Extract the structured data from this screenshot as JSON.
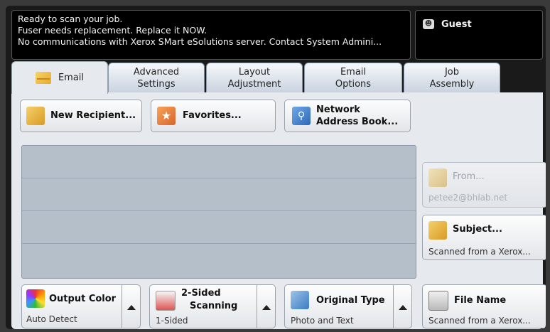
{
  "status": {
    "lines": [
      "Ready to scan your job.",
      "Fuser needs replacement.  Replace it NOW.",
      "No communications with Xerox SMart eSolutions server. Contact System Admini..."
    ]
  },
  "user": {
    "label": "Guest",
    "icon": "user-icon"
  },
  "tabs": [
    {
      "label": "Email",
      "line2": ""
    },
    {
      "label": "Advanced",
      "line2": "Settings"
    },
    {
      "label": "Layout",
      "line2": "Adjustment"
    },
    {
      "label": "Email",
      "line2": "Options"
    },
    {
      "label": "Job",
      "line2": "Assembly"
    }
  ],
  "actions": {
    "new_recipient": "New Recipient...",
    "favorites": "Favorites...",
    "network_line1": "Network",
    "network_line2": "Address Book..."
  },
  "from": {
    "label": "From...",
    "value": "petee2@bhlab.net"
  },
  "subject": {
    "label": "Subject...",
    "value": "Scanned from a Xerox..."
  },
  "bottom": {
    "output_color": {
      "label": "Output Color",
      "value": "Auto Detect"
    },
    "two_sided": {
      "label1": "2-Sided",
      "label2": "Scanning",
      "value": "1-Sided"
    },
    "original_type": {
      "label": "Original Type",
      "value": "Photo and Text"
    },
    "file_name": {
      "label": "File Name",
      "value": "Scanned from a Xerox..."
    }
  }
}
